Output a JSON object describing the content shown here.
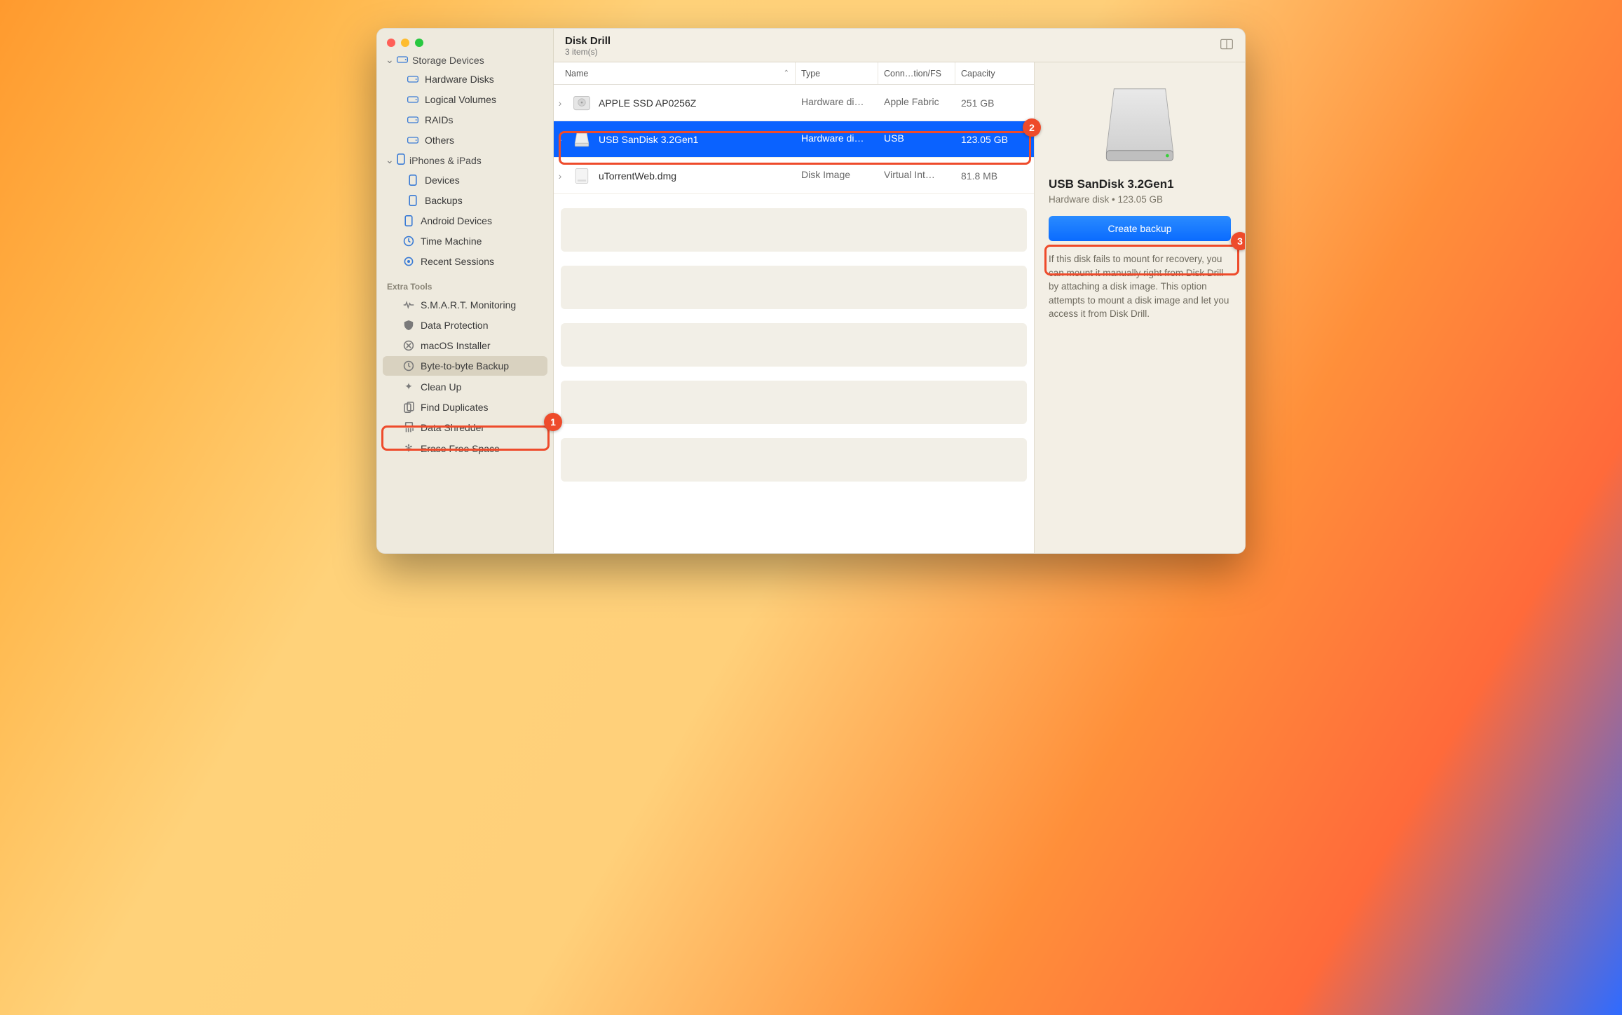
{
  "app": {
    "title": "Disk Drill",
    "items_sub": "3 item(s)"
  },
  "sidebar": {
    "group_storage": "Storage Devices",
    "storage_items": [
      "Hardware Disks",
      "Logical Volumes",
      "RAIDs",
      "Others"
    ],
    "group_mobile": "iPhones & iPads",
    "mobile_items": [
      "Devices",
      "Backups"
    ],
    "android": "Android Devices",
    "timemachine": "Time Machine",
    "recent": "Recent Sessions",
    "extra_label": "Extra Tools",
    "extra_items": [
      "S.M.A.R.T. Monitoring",
      "Data Protection",
      "macOS Installer",
      "Byte-to-byte Backup",
      "Clean Up",
      "Find Duplicates",
      "Data Shredder",
      "Erase Free Space"
    ],
    "selected_extra_index": 3
  },
  "columns": {
    "name": "Name",
    "type": "Type",
    "conn": "Conn…tion/FS",
    "cap": "Capacity"
  },
  "rows": [
    {
      "name": "APPLE SSD AP0256Z",
      "type": "Hardware di…",
      "conn": "Apple Fabric",
      "cap": "251 GB",
      "selected": false
    },
    {
      "name": "USB  SanDisk 3.2Gen1",
      "type": "Hardware di…",
      "conn": "USB",
      "cap": "123.05 GB",
      "selected": true
    },
    {
      "name": "uTorrentWeb.dmg",
      "type": "Disk Image",
      "conn": "Virtual Int…",
      "cap": "81.8 MB",
      "selected": false
    }
  ],
  "details": {
    "title": "USB  SanDisk 3.2Gen1",
    "meta": "Hardware disk • 123.05 GB",
    "button": "Create backup",
    "help": "If this disk fails to mount for recovery, you can mount it manually right from Disk Drill by attaching a disk image. This option attempts to mount a disk image and let you access it from Disk Drill."
  },
  "annotations": {
    "b1": "1",
    "b2": "2",
    "b3": "3"
  }
}
